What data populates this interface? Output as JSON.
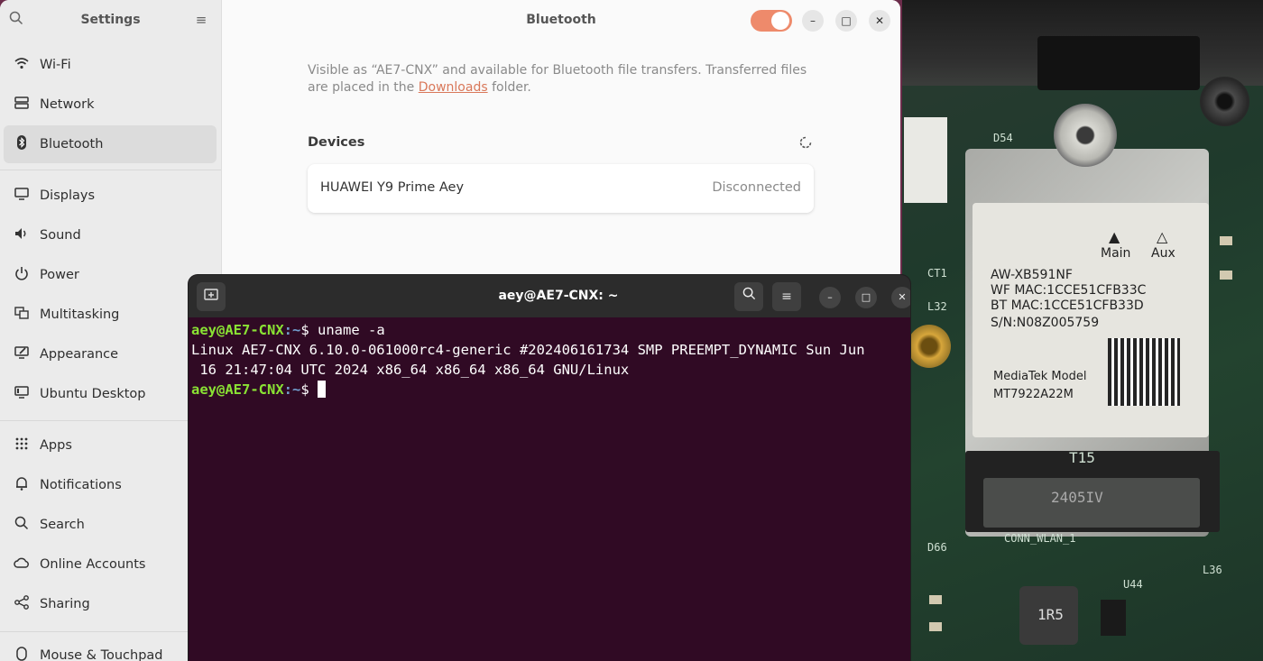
{
  "settings": {
    "sidebar_title": "Settings",
    "nav": [
      {
        "label": "Wi-Fi",
        "icon": "wifi-icon"
      },
      {
        "label": "Network",
        "icon": "network-icon"
      },
      {
        "label": "Bluetooth",
        "icon": "bluetooth-icon"
      },
      {
        "label": "Displays",
        "icon": "display-icon"
      },
      {
        "label": "Sound",
        "icon": "speaker-icon"
      },
      {
        "label": "Power",
        "icon": "power-icon"
      },
      {
        "label": "Multitasking",
        "icon": "multitasking-icon"
      },
      {
        "label": "Appearance",
        "icon": "appearance-icon"
      },
      {
        "label": "Ubuntu Desktop",
        "icon": "ubuntu-desktop-icon"
      },
      {
        "label": "Apps",
        "icon": "apps-icon"
      },
      {
        "label": "Notifications",
        "icon": "bell-icon"
      },
      {
        "label": "Search",
        "icon": "search-icon"
      },
      {
        "label": "Online Accounts",
        "icon": "cloud-icon"
      },
      {
        "label": "Sharing",
        "icon": "share-icon"
      },
      {
        "label": "Mouse & Touchpad",
        "icon": "mouse-icon"
      }
    ],
    "active_item": "Bluetooth",
    "content": {
      "title": "Bluetooth",
      "toggle_on": true,
      "description_before": "Visible as “AE7-CNX” and available for Bluetooth file transfers. Transferred files are placed in the ",
      "description_link": "Downloads",
      "description_after": " folder.",
      "devices_heading": "Devices",
      "devices": [
        {
          "name": "HUAWEI Y9 Prime Aey",
          "status": "Disconnected"
        }
      ]
    },
    "accent_color": "#ee8a6b"
  },
  "terminal": {
    "title": "aey@AE7-CNX: ~",
    "prompt_user": "aey@AE7-CNX",
    "prompt_path": ":~",
    "prompt_symbol": "$ ",
    "command": "uname -a",
    "output_line1": "Linux AE7-CNX 6.10.0-061000rc4-generic #202406161734 SMP PREEMPT_DYNAMIC Sun Jun",
    "output_line2": " 16 21:47:04 UTC 2024 x86_64 x86_64 x86_64 GNU/Linux",
    "background_color": "#300a24"
  },
  "photo": {
    "label_lines": [
      "AW-XB591NF",
      "WF MAC:1CCE51CFB33C",
      "BT MAC:1CCE51CFB33D",
      "S/N:N08Z005759"
    ],
    "model_line1": "MediaTek Model",
    "model_line2": "MT7922A22M",
    "antenna_main": "Main",
    "antenna_aux": "Aux",
    "silk_t15": "T15",
    "silk_slot": "2405IV",
    "silk_conn": "CONN_WLAN_1",
    "silk_u44": "U44",
    "silk_l36": "L36",
    "silk_1r5": "1R5",
    "silk_d54": "D54",
    "silk_ct1": "CT1",
    "silk_l32": "L32",
    "silk_d66": "D66"
  }
}
